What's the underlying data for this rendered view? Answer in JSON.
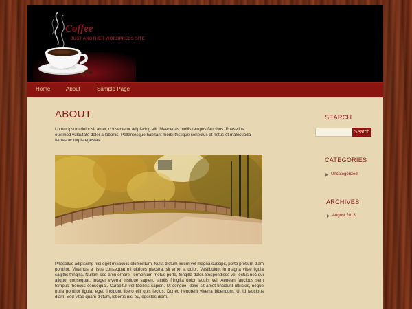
{
  "site": {
    "title": "Coffee",
    "tagline": "JUST ANOTHER WORDPRESS SITE"
  },
  "nav": {
    "items": [
      {
        "label": "Home"
      },
      {
        "label": "About"
      },
      {
        "label": "Sample Page"
      }
    ]
  },
  "main": {
    "title": "ABOUT",
    "intro": "Lorem ipsum dolor sit amet, consectetur adipiscing elit. Maecenas mollis tempus faucibus. Phasellus euismod vulputate dolor a lobortis. Pellentesque habitant morbi tristique senectus et netus et malesuada fames ac turpis egestas.",
    "body": "Phasellus adipiscing nisi eget mi iaculis elementum. Nulla dictum lorem vel magna suscipit, porta pretium diam porttitor. Vivamus a risus consequat mi ultrices placerat sit amet a dolor. Vestibulum in magna vitae ligula sagittis fringilla. Nullam sed arcu ornare, fermentum metus porta, fringilla dolor. Suspendisse vel lectus nec dui aliquet consequat. Integer viverra tristique sapien, iaculis fringilla dolor iaculis vel. Aenean faucibus sem tempus rhoncus consequat. Curabitur vel facilisis sapien. Ut congue, dolor sit amet tincidunt ultricies, neque nulla porttitor ligula, eget tincidunt libero elit quis lectus. Donec hendrerit viverra bibendum. Ut id faucibus diam. Sed vitae quam dictum, lobortis nisl eu, egestas diam."
  },
  "sidebar": {
    "search": {
      "title": "SEARCH",
      "value": "",
      "button_label": "Search"
    },
    "categories": {
      "title": "CATEGORIES",
      "items": [
        {
          "label": "Uncategorized"
        }
      ]
    },
    "archives": {
      "title": "ARCHIVES",
      "items": [
        {
          "label": "August 2013"
        }
      ]
    }
  },
  "colors": {
    "accent": "#8a1a1a",
    "nav_bar": "#8a1410",
    "content_bg": "#e7d7b3",
    "header_bg": "#000000"
  },
  "icons": [
    "coffee-cup-icon",
    "bullet-icon"
  ]
}
